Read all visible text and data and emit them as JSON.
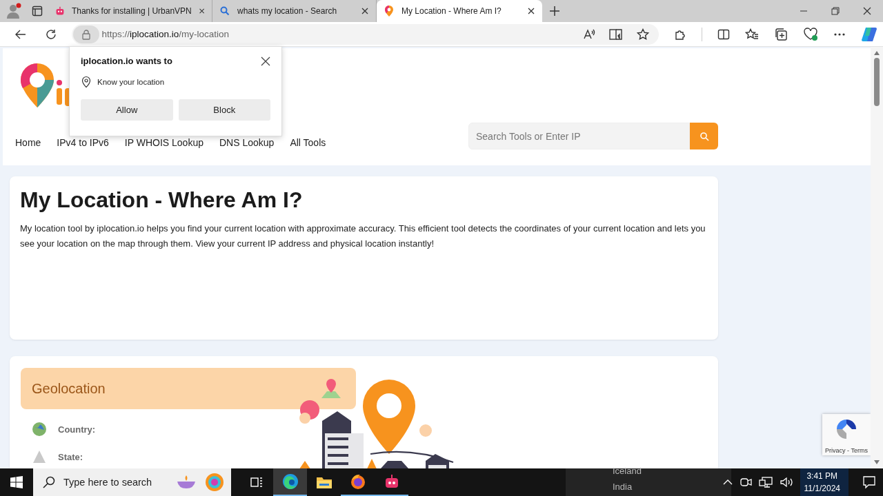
{
  "browser": {
    "tabs": [
      {
        "title": "Thanks for installing | UrbanVPN",
        "kind": "robot",
        "selected": false
      },
      {
        "title": "whats my location - Search",
        "kind": "search",
        "selected": false
      },
      {
        "title": "My Location - Where Am I?",
        "kind": "pin",
        "selected": true
      }
    ],
    "address": {
      "scheme": "https://",
      "host": "iplocation.io",
      "path": "/my-location"
    }
  },
  "permission_popup": {
    "title": "iplocation.io wants to",
    "request": "Know your location",
    "buttons": [
      "Allow",
      "Block"
    ]
  },
  "site": {
    "nav": [
      "Home",
      "IPv4 to IPv6",
      "IP WHOIS Lookup",
      "DNS Lookup",
      "All Tools"
    ],
    "search": {
      "placeholder": "Search Tools or Enter IP"
    }
  },
  "intro": {
    "title": "My Location - Where Am I?",
    "text": "My location tool by iplocation.io helps you find your current location with approximate accuracy. This efficient tool detects the coordinates of your current location and lets you see your location on the map through them. View your current IP address and physical location instantly!"
  },
  "geolocation": {
    "title": "Geolocation",
    "fields": [
      "Country:",
      "State:"
    ]
  },
  "recaptcha": {
    "links": "Privacy - Terms"
  },
  "taskbar": {
    "search_placeholder": "Type here to search",
    "apps": [
      {
        "kind": "task-view",
        "running": false,
        "active": false
      },
      {
        "kind": "edge",
        "running": true,
        "active": true
      },
      {
        "kind": "folder",
        "running": false,
        "active": false
      },
      {
        "kind": "firefox",
        "running": true,
        "active": false
      },
      {
        "kind": "robot",
        "running": true,
        "active": false
      }
    ],
    "desktop_texts": [
      "Iceland",
      "India"
    ],
    "time": "3:41 PM",
    "date": "11/1/2024"
  }
}
